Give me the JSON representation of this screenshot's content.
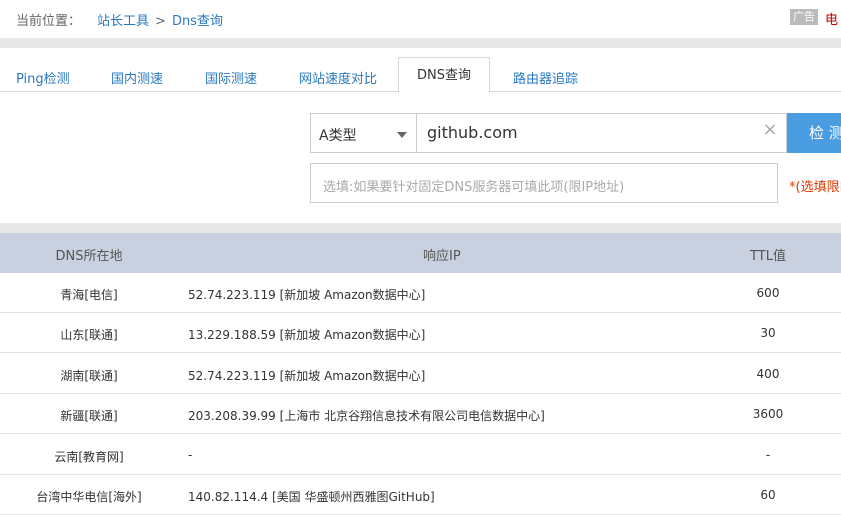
{
  "breadcrumb": {
    "prefix": "当前位置：",
    "crumb1": "站长工具",
    "separator": ">",
    "crumb2": "Dns查询"
  },
  "ad": {
    "badge": "广告",
    "text": "电"
  },
  "tabs": [
    {
      "label": "Ping检测"
    },
    {
      "label": "国内测速"
    },
    {
      "label": "国际测速"
    },
    {
      "label": "网站速度对比"
    },
    {
      "label": "DNS查询"
    },
    {
      "label": "路由器追踪"
    }
  ],
  "query": {
    "record_type": "A类型",
    "domain": "github.com",
    "submit_label": "检 测",
    "dns_placeholder": "选填:如果要针对固定DNS服务器可填此项(限IP地址)",
    "dns_hint": "*(选填限IP"
  },
  "table": {
    "headers": {
      "location": "DNS所在地",
      "ip": "响应IP",
      "ttl": "TTL值"
    },
    "rows": [
      {
        "location": "青海[电信]",
        "ip": "52.74.223.119 [新加坡 Amazon数据中心]",
        "ttl": "600"
      },
      {
        "location": "山东[联通]",
        "ip": "13.229.188.59 [新加坡 Amazon数据中心]",
        "ttl": "30"
      },
      {
        "location": "湖南[联通]",
        "ip": "52.74.223.119 [新加坡 Amazon数据中心]",
        "ttl": "400"
      },
      {
        "location": "新疆[联通]",
        "ip": "203.208.39.99 [上海市 北京谷翔信息技术有限公司电信数据中心]",
        "ttl": "3600"
      },
      {
        "location": "云南[教育网]",
        "ip": "-",
        "ttl": "-"
      },
      {
        "location": "台湾中华电信[海外]",
        "ip": "140.82.114.4 [美国 华盛顿州西雅图GitHub]",
        "ttl": "60"
      }
    ]
  },
  "colors": {
    "link": "#2a78c1",
    "primary_button": "#4a9de1",
    "table_header": "#c9d1e0",
    "hint": "#e03a00"
  }
}
